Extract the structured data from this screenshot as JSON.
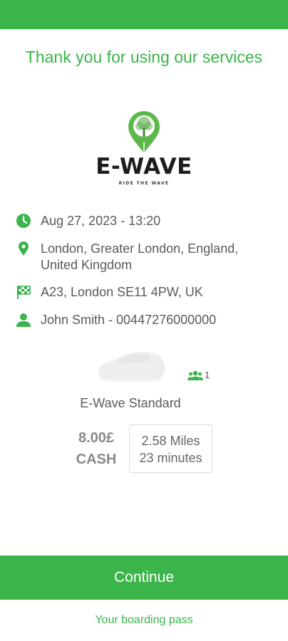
{
  "header": {
    "thanks_text": "Thank you for using our services"
  },
  "logo": {
    "wordmark": "E-WAVE",
    "tagline": "RIDE THE WAVE"
  },
  "trip": {
    "datetime": "Aug 27, 2023 - 13:20",
    "pickup": "London, Greater London, England, United Kingdom",
    "dropoff": "A23, London SE11 4PW, UK",
    "passenger": "John Smith - 00447276000000"
  },
  "vehicle": {
    "name": "E-Wave Standard",
    "passenger_count": "1"
  },
  "fare": {
    "amount": "8.00£",
    "method": "CASH",
    "distance": "2.58 Miles",
    "duration": "23 minutes"
  },
  "actions": {
    "continue_label": "Continue",
    "boarding_pass_label": "Your boarding pass"
  },
  "colors": {
    "accent": "#3bb44a",
    "text": "#5a5a5a"
  },
  "icons": {
    "datetime": "clock-icon",
    "pickup": "location-pin-icon",
    "dropoff": "checkered-flag-icon",
    "passenger": "person-icon",
    "pax": "group-icon"
  }
}
